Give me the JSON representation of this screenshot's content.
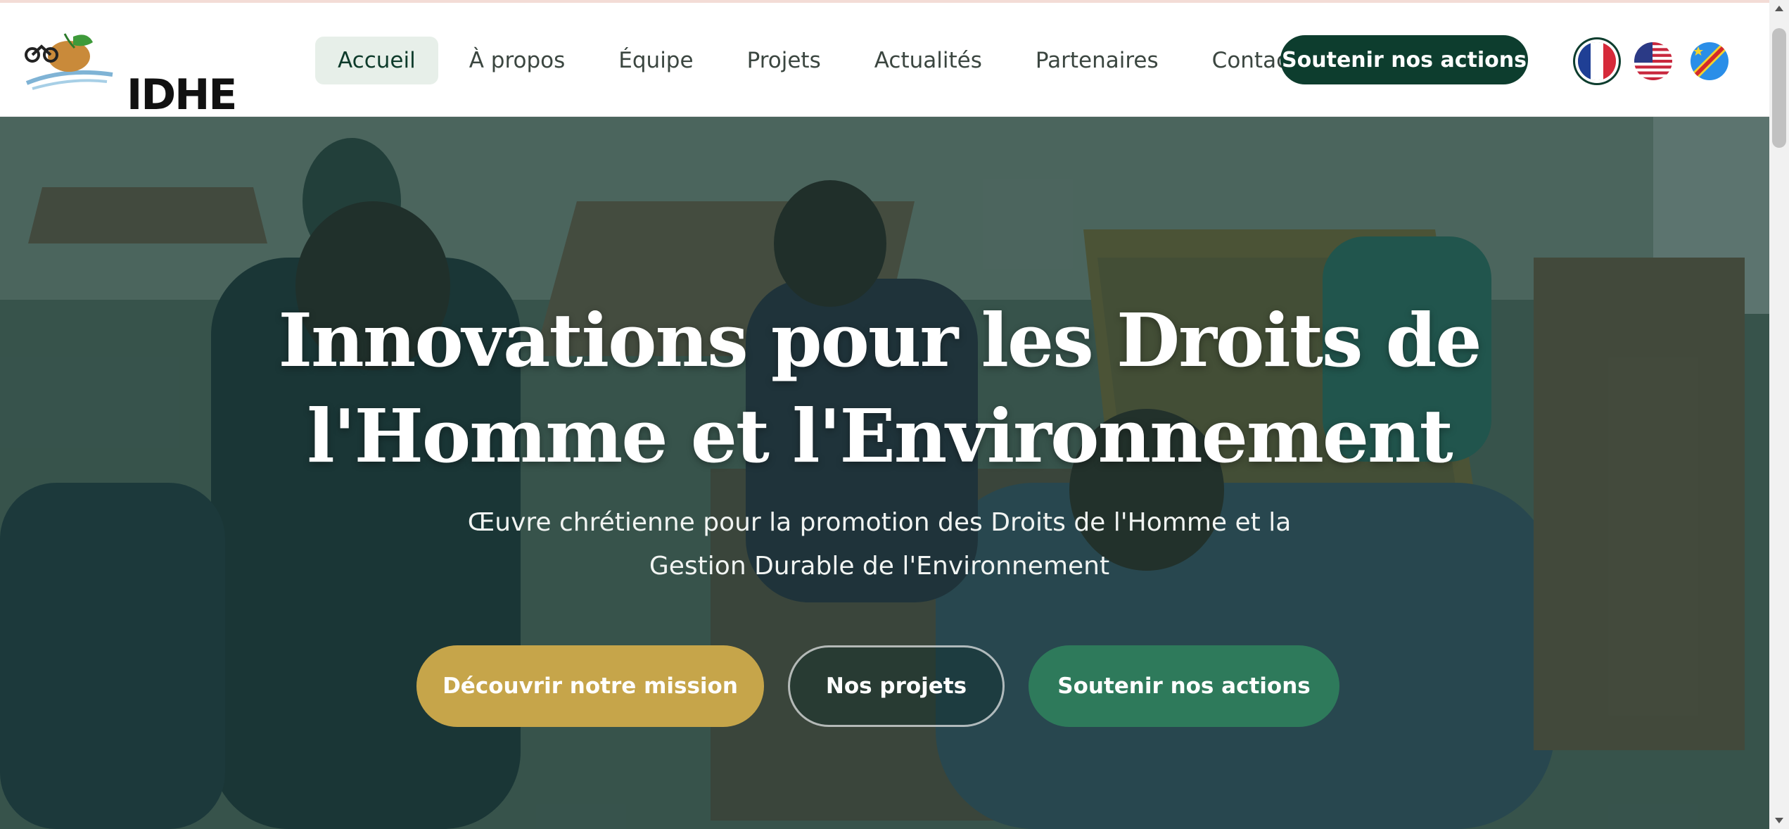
{
  "brand": {
    "logo_text": "IDHE"
  },
  "nav": {
    "items": [
      {
        "label": "Accueil",
        "active": true
      },
      {
        "label": "À propos",
        "active": false
      },
      {
        "label": "Équipe",
        "active": false
      },
      {
        "label": "Projets",
        "active": false
      },
      {
        "label": "Actualités",
        "active": false
      },
      {
        "label": "Partenaires",
        "active": false
      },
      {
        "label": "Contact",
        "active": false
      }
    ],
    "cta_label": "Soutenir nos actions"
  },
  "languages": [
    {
      "name": "france-flag-icon",
      "selected": true
    },
    {
      "name": "usa-flag-icon",
      "selected": false
    },
    {
      "name": "drc-flag-icon",
      "selected": false
    }
  ],
  "hero": {
    "title_line1": "Innovations pour les Droits de",
    "title_line2": "l'Homme et l'Environnement",
    "subtitle_line1": "Œuvre chrétienne pour la promotion des Droits de l'Homme et la",
    "subtitle_line2": "Gestion Durable de l'Environnement",
    "buttons": {
      "mission": "Découvrir notre mission",
      "projects": "Nos projets",
      "support": "Soutenir nos actions"
    }
  },
  "colors": {
    "brand_dark_green": "#0d3d2e",
    "accent_gold": "#c6a54a",
    "accent_green": "#2e7a5b",
    "nav_active_bg": "#e7efe9"
  }
}
